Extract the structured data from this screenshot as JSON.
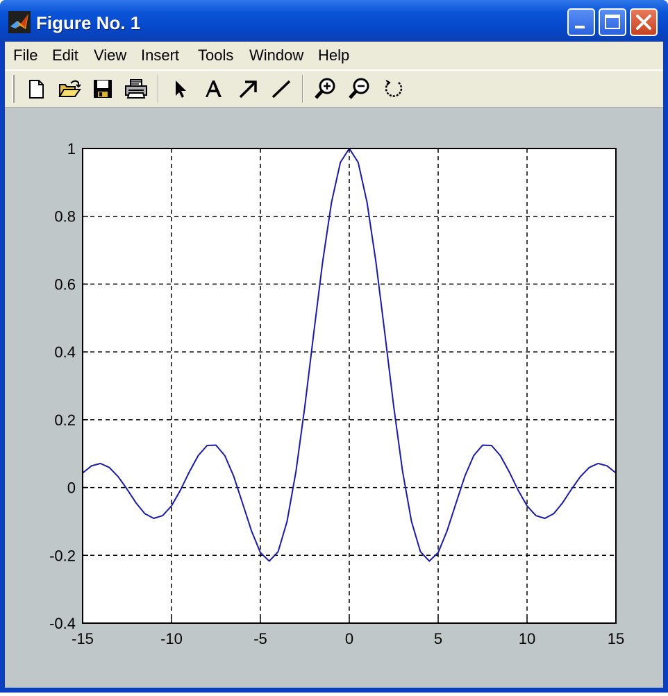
{
  "window": {
    "title": "Figure No. 1",
    "icon": "matlab-icon",
    "controls": [
      "minimize-icon",
      "maximize-icon",
      "close-icon"
    ]
  },
  "menubar": {
    "items": [
      {
        "label": "File"
      },
      {
        "label": "Edit"
      },
      {
        "label": "View"
      },
      {
        "label": "Insert"
      },
      {
        "label": "Tools"
      },
      {
        "label": "Window"
      },
      {
        "label": "Help"
      }
    ]
  },
  "toolbar": {
    "tools": [
      "new-figure-icon",
      "open-icon",
      "save-icon",
      "print-icon",
      "select-arrow-icon",
      "insert-text-icon",
      "insert-arrow-icon",
      "insert-line-icon",
      "zoom-in-icon",
      "zoom-out-icon",
      "rotate-icon"
    ]
  },
  "colors": {
    "titlebar": "#0646c9",
    "client_bg": "#c0c7c8",
    "menu_bg": "#ecead8",
    "line": "#1a1aa8"
  },
  "chart_data": {
    "type": "line",
    "title": "",
    "xlabel": "",
    "ylabel": "",
    "xlim": [
      -15,
      15
    ],
    "ylim": [
      -0.4,
      1
    ],
    "xticks": [
      -15,
      -10,
      -5,
      0,
      5,
      10,
      15
    ],
    "yticks": [
      -0.4,
      -0.2,
      0,
      0.2,
      0.4,
      0.6,
      0.8,
      1
    ],
    "xtick_labels": [
      "-15",
      "-10",
      "-5",
      "0",
      "5",
      "10",
      "15"
    ],
    "ytick_labels": [
      "-0.4",
      "-0.2",
      "0",
      "0.2",
      "0.4",
      "0.6",
      "0.8",
      "1"
    ],
    "grid": true,
    "grid_style": "dashed",
    "series": [
      {
        "color": "#1a1aa8",
        "x": [
          -15,
          -14.5,
          -14,
          -13.5,
          -13,
          -12.5,
          -12,
          -11.5,
          -11,
          -10.5,
          -10,
          -9.5,
          -9,
          -8.5,
          -8,
          -7.5,
          -7,
          -6.5,
          -6,
          -5.5,
          -5,
          -4.5,
          -4,
          -3.5,
          -3,
          -2.5,
          -2,
          -1.5,
          -1,
          -0.5,
          0,
          0.5,
          1,
          1.5,
          2,
          2.5,
          3,
          3.5,
          4,
          4.5,
          5,
          5.5,
          6,
          6.5,
          7,
          7.5,
          8,
          8.5,
          9,
          9.5,
          10,
          10.5,
          11,
          11.5,
          12,
          12.5,
          13,
          13.5,
          14,
          14.5,
          15
        ],
        "y": [
          0.043,
          0.064,
          0.071,
          0.059,
          0.032,
          -0.005,
          -0.045,
          -0.077,
          -0.091,
          -0.083,
          -0.054,
          -0.008,
          0.046,
          0.094,
          0.124,
          0.125,
          0.094,
          0.033,
          -0.047,
          -0.128,
          -0.192,
          -0.217,
          -0.189,
          -0.1,
          0.047,
          0.239,
          0.455,
          0.665,
          0.841,
          0.959,
          1,
          0.959,
          0.841,
          0.665,
          0.455,
          0.239,
          0.047,
          -0.1,
          -0.189,
          -0.217,
          -0.192,
          -0.128,
          -0.047,
          0.033,
          0.094,
          0.125,
          0.124,
          0.094,
          0.046,
          -0.008,
          -0.054,
          -0.083,
          -0.091,
          -0.077,
          -0.045,
          -0.005,
          0.032,
          0.059,
          0.071,
          0.064,
          0.043
        ]
      }
    ]
  }
}
